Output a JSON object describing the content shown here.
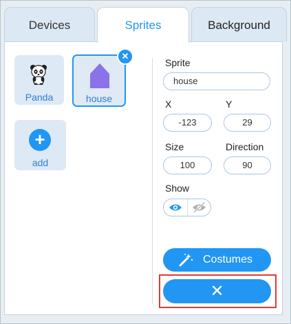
{
  "tabs": [
    {
      "label": "Devices"
    },
    {
      "label": "Sprites",
      "active": true
    },
    {
      "label": "Background"
    }
  ],
  "sprites": [
    {
      "name": "Panda",
      "icon": "panda-icon"
    },
    {
      "name": "house",
      "icon": "house-icon",
      "selected": true
    }
  ],
  "add": {
    "label": "add",
    "icon": "plus-icon"
  },
  "properties": {
    "sprite_label": "Sprite",
    "sprite_value": "house",
    "x_label": "X",
    "x_value": "-123",
    "y_label": "Y",
    "y_value": "29",
    "size_label": "Size",
    "size_value": "100",
    "direction_label": "Direction",
    "direction_value": "90",
    "show_label": "Show",
    "show_state": "visible"
  },
  "buttons": {
    "costumes_label": "Costumes",
    "close_symbol": "✕"
  },
  "colors": {
    "accent": "#2196f3",
    "highlight": "#e53935"
  }
}
